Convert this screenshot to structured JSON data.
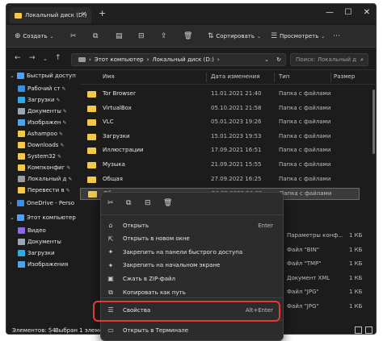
{
  "window": {
    "tab_title": "Локальный диск (D:)",
    "tab_close": "✕",
    "new_tab": "+",
    "minimize": "—",
    "maximize": "☐",
    "close": "✕"
  },
  "toolbar": {
    "create_label": "Создать",
    "sort_label": "Сортировать",
    "view_label": "Просмотреть",
    "more": "⋯"
  },
  "address": {
    "crumb_root": "Этот компьютер",
    "crumb_current": "Локальный диск (D:)",
    "search_placeholder": "Поиск: Локальный д"
  },
  "sidebar": {
    "items": [
      {
        "label": "Быстрый доступ",
        "color": "#4aa3ff",
        "pinned": false
      },
      {
        "label": "Рабочий ст",
        "color": "#3d8fd8",
        "pinned": true
      },
      {
        "label": "Загрузки",
        "color": "#35a8e0",
        "pinned": true
      },
      {
        "label": "Документы",
        "color": "#9aa7b5",
        "pinned": true
      },
      {
        "label": "Изображен",
        "color": "#4fa3e8",
        "pinned": true
      },
      {
        "label": "Ashampoo",
        "color": "#f2c94c",
        "pinned": true
      },
      {
        "label": "Downloads",
        "color": "#f2c94c",
        "pinned": true
      },
      {
        "label": "System32",
        "color": "#f2c94c",
        "pinned": true
      },
      {
        "label": "Компконфиг",
        "color": "#f2c94c",
        "pinned": true
      },
      {
        "label": "Локальный д",
        "color": "#9a9a9a",
        "pinned": true
      },
      {
        "label": "Перевести в",
        "color": "#f2c94c",
        "pinned": true
      },
      {
        "label": "OneDrive - Perso",
        "color": "#3b8ee8",
        "pinned": false
      },
      {
        "label": "Этот компьютер",
        "color": "#4aa3ff",
        "pinned": false
      },
      {
        "label": "Видео",
        "color": "#8e6ae0",
        "pinned": false
      },
      {
        "label": "Документы",
        "color": "#9aa7b5",
        "pinned": false
      },
      {
        "label": "Загрузки",
        "color": "#35a8e0",
        "pinned": false
      },
      {
        "label": "Изображения",
        "color": "#4fa3e8",
        "pinned": false
      }
    ]
  },
  "columns": {
    "name": "Имя",
    "date": "Дата изменения",
    "type": "Тип",
    "size": "Размер"
  },
  "files": [
    {
      "name": "Tor Browser",
      "date": "11.01.2021 21:40",
      "type": "Папка с файлами",
      "size": ""
    },
    {
      "name": "VirtualBox",
      "date": "05.10.2021 21:58",
      "type": "Папка с файлами",
      "size": ""
    },
    {
      "name": "VLC",
      "date": "05.01.2023 19:26",
      "type": "Папка с файлами",
      "size": ""
    },
    {
      "name": "Загрузки",
      "date": "15.01.2023 19:53",
      "type": "Папка с файлами",
      "size": ""
    },
    {
      "name": "Иллюстрации",
      "date": "17.09.2021 16:51",
      "type": "Папка с файлами",
      "size": ""
    },
    {
      "name": "Музыка",
      "date": "21.09.2021 15:55",
      "type": "Папка с файлами",
      "size": ""
    },
    {
      "name": "Общая",
      "date": "27.09.2022 16:25",
      "type": "Папка с файлами",
      "size": ""
    },
    {
      "name": "Общая папка",
      "date": "26.02.2023 20:33",
      "type": "Папка с файлами",
      "size": ""
    }
  ],
  "partial_rows": [
    {
      "name": "",
      "date": "",
      "type": "Параметры конф...",
      "size": "1 КБ"
    },
    {
      "name": "",
      "date": "",
      "type": "Файл \"BIN\"",
      "size": "1 КБ"
    },
    {
      "name": "",
      "date": "",
      "type": "Файл \"TMP\"",
      "size": "1 КБ"
    },
    {
      "name": "",
      "date": "",
      "type": "Документ XML",
      "size": "1 КБ"
    },
    {
      "name": "",
      "date": "",
      "type": "Файл \"JPG\"",
      "size": "1 КБ"
    },
    {
      "name": "",
      "date": "",
      "type": "Файл \"JPG\"",
      "size": "1 КБ"
    }
  ],
  "context_menu": {
    "items": [
      {
        "label": "Открыть",
        "shortcut": "Enter",
        "icon": "⌂"
      },
      {
        "label": "Открыть в новом окне",
        "shortcut": "",
        "icon": "⇱"
      },
      {
        "label": "Закрепить на панели быстрого доступа",
        "shortcut": "",
        "icon": "✦"
      },
      {
        "label": "Закрепить на начальном экране",
        "shortcut": "",
        "icon": "✦"
      },
      {
        "label": "Сжать в ZIP-файл",
        "shortcut": "",
        "icon": "▣"
      },
      {
        "label": "Копировать как путь",
        "shortcut": "",
        "icon": "⧉"
      }
    ],
    "properties_label": "Свойства",
    "properties_shortcut": "Alt+Enter",
    "terminal_label": "Открыть в Терминале"
  },
  "status": {
    "count": "Элементов: 54",
    "selected": "Выбран 1 элемент"
  },
  "colors": {
    "folder": "#f2c94c",
    "highlight": "#e53935",
    "background": "#1c1c1c"
  }
}
